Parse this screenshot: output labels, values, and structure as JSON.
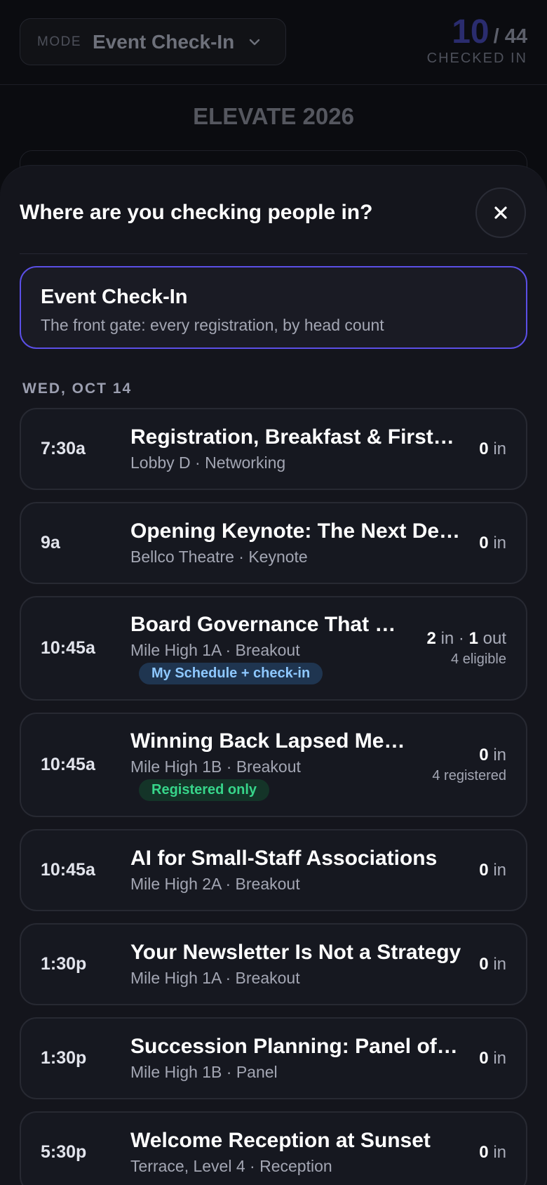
{
  "header": {
    "mode_label": "MODE",
    "mode_value": "Event Check-In",
    "checked_count": "10",
    "checked_total": "/ 44",
    "checked_label": "CHECKED IN"
  },
  "event": {
    "title": "ELEVATE 2026"
  },
  "sheet": {
    "title": "Where are you checking people in?",
    "close_icon": "close-icon",
    "main_option": {
      "title": "Event Check-In",
      "subtitle": "The front gate: every registration, by head count"
    },
    "day_label": "WED, OCT 14",
    "sessions": [
      {
        "time": "7:30a",
        "title": "Registration, Breakfast & First…",
        "sub": "Lobby D · Networking",
        "in": "0",
        "in_label": "in"
      },
      {
        "time": "9a",
        "title": "Opening Keynote: The Next De…",
        "sub": "Bellco Theatre · Keynote",
        "in": "0",
        "in_label": "in"
      },
      {
        "time": "10:45a",
        "title": "Board Governance That …",
        "sub": "Mile High 1A · Breakout",
        "badge": "My Schedule + check-in",
        "in": "2",
        "in_label": "in ·",
        "out": "1",
        "out_label": "out",
        "detail": "4 eligible"
      },
      {
        "time": "10:45a",
        "title": "Winning Back Lapsed Me…",
        "sub": "Mile High 1B · Breakout",
        "badge": "Registered only",
        "in": "0",
        "in_label": "in",
        "detail": "4 registered"
      },
      {
        "time": "10:45a",
        "title": "AI for Small-Staff Associations",
        "sub": "Mile High 2A · Breakout",
        "in": "0",
        "in_label": "in"
      },
      {
        "time": "1:30p",
        "title": "Your Newsletter Is Not a Strategy",
        "sub": "Mile High 1A · Breakout",
        "in": "0",
        "in_label": "in"
      },
      {
        "time": "1:30p",
        "title": "Succession Planning: Panel of…",
        "sub": "Mile High 1B · Panel",
        "in": "0",
        "in_label": "in"
      },
      {
        "time": "5:30p",
        "title": "Welcome Reception at Sunset",
        "sub": "Terrace, Level 4 · Reception",
        "in": "0",
        "in_label": "in"
      }
    ]
  },
  "colors": {
    "accent": "#5b4fe6",
    "badge_blue": "#8ec8ff",
    "badge_green": "#37d58a"
  }
}
